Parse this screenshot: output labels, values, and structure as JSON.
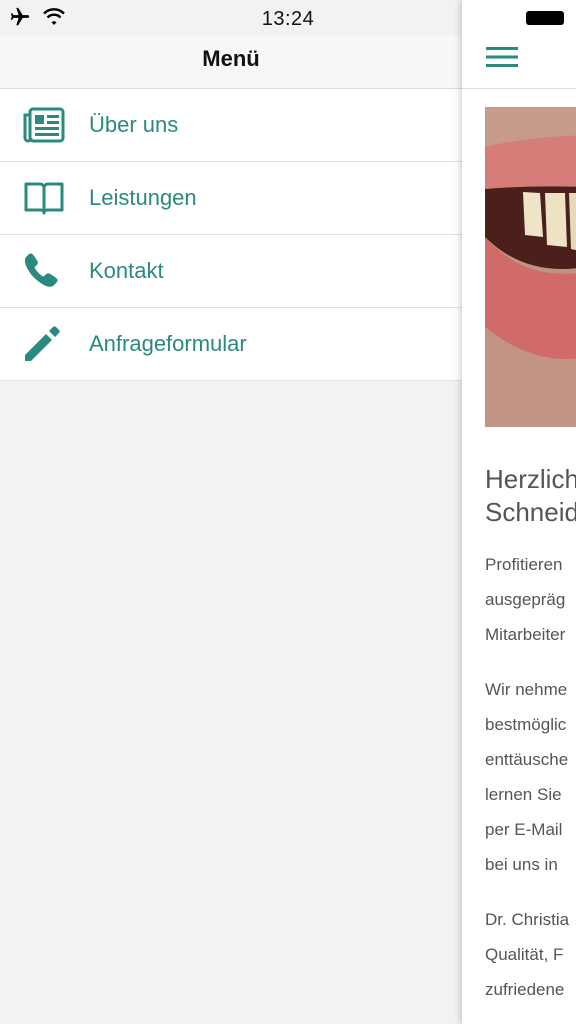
{
  "status_bar": {
    "time": "13:24"
  },
  "drawer": {
    "title": "Menü",
    "items": [
      {
        "label": "Über uns",
        "icon": "newspaper-icon"
      },
      {
        "label": "Leistungen",
        "icon": "book-icon"
      },
      {
        "label": "Kontakt",
        "icon": "phone-icon"
      },
      {
        "label": "Anfrageformular",
        "icon": "pencil-icon"
      }
    ]
  },
  "content": {
    "heading_line1": "Herzlich",
    "heading_line2": "Schneid",
    "paragraph1": [
      "Profitieren",
      "ausgepräg",
      "Mitarbeiter"
    ],
    "paragraph2": [
      "Wir nehme",
      "bestmöglic",
      "enttäusche",
      "lernen Sie",
      "per E-Mail",
      "bei uns in"
    ],
    "paragraph3": [
      "Dr. Christia",
      "Qualität, F",
      "zufriedene"
    ]
  },
  "colors": {
    "accent": "#2a8a7e",
    "text": "#555555"
  }
}
